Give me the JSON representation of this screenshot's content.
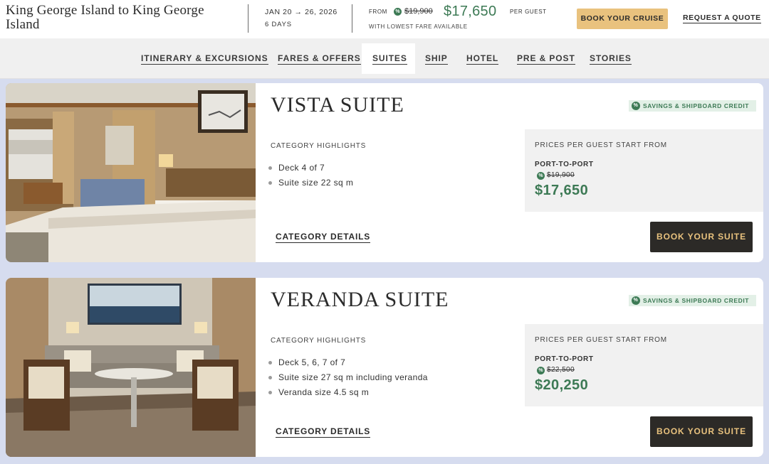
{
  "header": {
    "trip_title": "King George Island to King George Island",
    "dates": "JAN 20 → 26, 2026",
    "days": "6 DAYS",
    "from_label": "FROM",
    "old_price": "$19,900",
    "price": "$17,650",
    "per_guest": "PER GUEST",
    "lowest_fare": "WITH LOWEST FARE AVAILABLE",
    "book_cruise_label": "BOOK YOUR CRUISE",
    "request_quote_label": "REQUEST A QUOTE",
    "save_icon_glyph": "%"
  },
  "nav": {
    "tabs": [
      {
        "label": "ITINERARY & EXCURSIONS",
        "active": false
      },
      {
        "label": "FARES & OFFERS",
        "active": false
      },
      {
        "label": "SUITES",
        "active": true
      },
      {
        "label": "SHIP",
        "active": false
      },
      {
        "label": "HOTEL",
        "active": false
      },
      {
        "label": "PRE & POST",
        "active": false
      },
      {
        "label": "STORIES",
        "active": false
      }
    ]
  },
  "suites": [
    {
      "title": "VISTA SUITE",
      "badge": "SAVINGS & SHIPBOARD CREDIT",
      "highlights_label": "CATEGORY HIGHLIGHTS",
      "highlights": [
        "Deck 4 of 7",
        "Suite size 22 sq m"
      ],
      "prices_label": "PRICES PER GUEST START FROM",
      "fare_type": "PORT-TO-PORT",
      "old_price": "$19,900",
      "price": "$17,650",
      "details_label": "CATEGORY DETAILS",
      "book_label": "BOOK YOUR SUITE"
    },
    {
      "title": "VERANDA SUITE",
      "badge": "SAVINGS & SHIPBOARD CREDIT",
      "highlights_label": "CATEGORY HIGHLIGHTS",
      "highlights": [
        "Deck 5, 6, 7 of 7",
        "Suite size 27 sq m including veranda",
        "Veranda size 4.5 sq m"
      ],
      "prices_label": "PRICES PER GUEST START FROM",
      "fare_type": "PORT-TO-PORT",
      "old_price": "$22,500",
      "price": "$20,250",
      "details_label": "CATEGORY DETAILS",
      "book_label": "BOOK YOUR SUITE"
    }
  ],
  "colors": {
    "accent_green": "#3d7a55",
    "gold": "#e9c27e",
    "dark_button": "#2c2a27",
    "page_background": "#d6dcef"
  }
}
